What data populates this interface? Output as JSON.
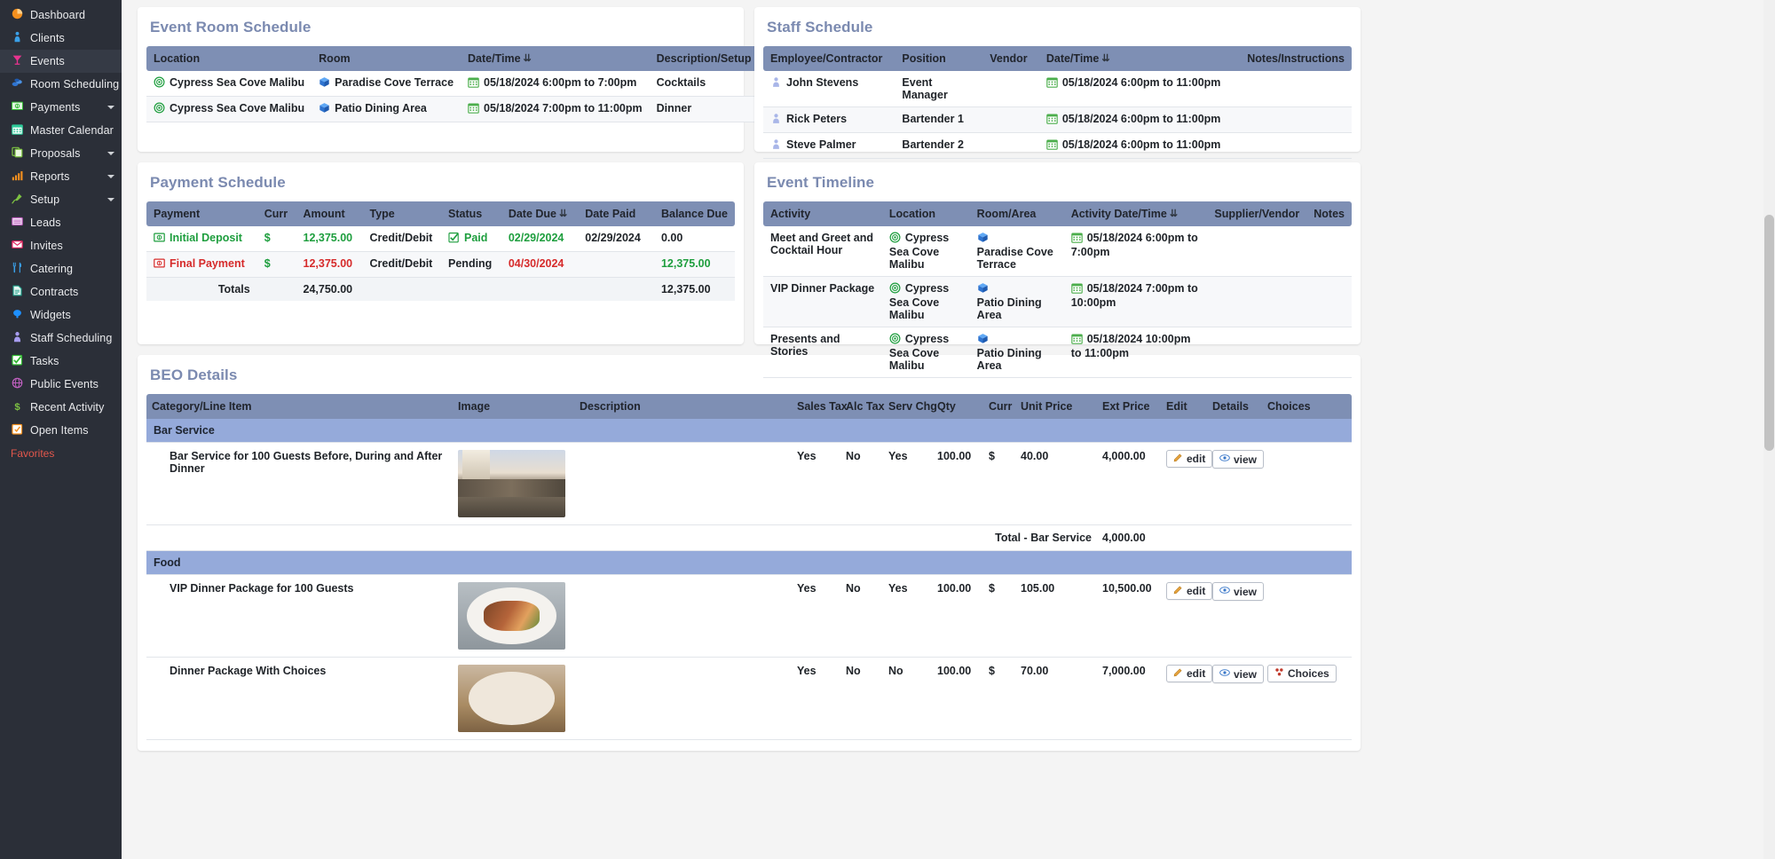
{
  "sidebar": {
    "items": [
      {
        "label": "Dashboard",
        "icon": "pie-chart-icon",
        "color": "#f5901e",
        "caret": false,
        "active": false
      },
      {
        "label": "Clients",
        "icon": "person-icon",
        "color": "#3aa0e8",
        "caret": false,
        "active": false
      },
      {
        "label": "Events",
        "icon": "cocktail-icon",
        "color": "#e8338f",
        "caret": false,
        "active": true
      },
      {
        "label": "Room Scheduling",
        "icon": "rooms-icon",
        "color": "#2f74d0",
        "caret": false,
        "active": false
      },
      {
        "label": "Payments",
        "icon": "money-icon",
        "color": "#2eb82e",
        "caret": true,
        "active": false
      },
      {
        "label": "Master Calendar",
        "icon": "calendar-icon",
        "color": "#2ecc9b",
        "caret": false,
        "active": false
      },
      {
        "label": "Proposals",
        "icon": "documents-icon",
        "color": "#7dc242",
        "caret": true,
        "active": false
      },
      {
        "label": "Reports",
        "icon": "bar-chart-icon",
        "color": "#f5901e",
        "caret": true,
        "active": false
      },
      {
        "label": "Setup",
        "icon": "plug-icon",
        "color": "#7dc242",
        "caret": true,
        "active": false
      },
      {
        "label": "Leads",
        "icon": "list-icon",
        "color": "#c060c0",
        "caret": false,
        "active": false
      },
      {
        "label": "Invites",
        "icon": "envelope-icon",
        "color": "#e0245e",
        "caret": false,
        "active": false
      },
      {
        "label": "Catering",
        "icon": "cutlery-icon",
        "color": "#3aa0e8",
        "caret": false,
        "active": false
      },
      {
        "label": "Contracts",
        "icon": "contract-icon",
        "color": "#1fa08a",
        "caret": false,
        "active": false
      },
      {
        "label": "Widgets",
        "icon": "widget-icon",
        "color": "#1e90ff",
        "caret": false,
        "active": false
      },
      {
        "label": "Staff Scheduling",
        "icon": "staff-icon",
        "color": "#a79cf0",
        "caret": false,
        "active": false
      },
      {
        "label": "Tasks",
        "icon": "checkbox-icon",
        "color": "#2eb82e",
        "caret": false,
        "active": false
      },
      {
        "label": "Public Events",
        "icon": "globe-icon",
        "color": "#c060c0",
        "caret": false,
        "active": false
      },
      {
        "label": "Recent Activity",
        "icon": "dollar-icon",
        "color": "#7dc242",
        "caret": false,
        "active": false
      },
      {
        "label": "Open Items",
        "icon": "openitems-icon",
        "color": "#f5901e",
        "caret": false,
        "active": false
      }
    ],
    "favorites_label": "Favorites"
  },
  "event_room_schedule": {
    "title": "Event Room Schedule",
    "columns": [
      "Location",
      "Room",
      "Date/Time",
      "Description/Setup"
    ],
    "sort_column": "Date/Time",
    "rows": [
      {
        "location": "Cypress Sea Cove Malibu",
        "room": "Paradise Cove Terrace",
        "datetime": "05/18/2024 6:00pm to 7:00pm",
        "description": "Cocktails"
      },
      {
        "location": "Cypress Sea Cove Malibu",
        "room": "Patio Dining Area",
        "datetime": "05/18/2024 7:00pm to 11:00pm",
        "description": "Dinner"
      }
    ]
  },
  "staff_schedule": {
    "title": "Staff Schedule",
    "columns": [
      "Employee/Contractor",
      "Position",
      "Vendor",
      "Date/Time",
      "Notes/Instructions"
    ],
    "sort_column": "Date/Time",
    "rows": [
      {
        "employee": "John Stevens",
        "position": "Event Manager",
        "vendor": "",
        "datetime": "05/18/2024 6:00pm to 11:00pm",
        "notes": ""
      },
      {
        "employee": "Rick Peters",
        "position": "Bartender 1",
        "vendor": "",
        "datetime": "05/18/2024 6:00pm to 11:00pm",
        "notes": ""
      },
      {
        "employee": "Steve Palmer",
        "position": "Bartender 2",
        "vendor": "",
        "datetime": "05/18/2024 6:00pm to 11:00pm",
        "notes": ""
      }
    ]
  },
  "payment_schedule": {
    "title": "Payment Schedule",
    "columns": [
      "Payment",
      "Curr",
      "Amount",
      "Type",
      "Status",
      "Date Due",
      "Date Paid",
      "Balance Due"
    ],
    "sort_column": "Date Due",
    "rows": [
      {
        "payment": "Initial Deposit",
        "curr": "$",
        "amount": "12,375.00",
        "type": "Credit/Debit",
        "status": "Paid",
        "date_due": "02/29/2024",
        "date_paid": "02/29/2024",
        "balance_due": "0.00",
        "state": "paid"
      },
      {
        "payment": "Final Payment",
        "curr": "$",
        "amount": "12,375.00",
        "type": "Credit/Debit",
        "status": "Pending",
        "date_due": "04/30/2024",
        "date_paid": "",
        "balance_due": "12,375.00",
        "state": "pending"
      }
    ],
    "totals_label": "Totals",
    "totals_amount": "24,750.00",
    "totals_balance": "12,375.00"
  },
  "event_timeline": {
    "title": "Event Timeline",
    "columns": [
      "Activity",
      "Location",
      "Room/Area",
      "Activity Date/Time",
      "Supplier/Vendor",
      "Notes"
    ],
    "sort_column": "Activity Date/Time",
    "rows": [
      {
        "activity": "Meet and Greet and Cocktail Hour",
        "location": "Cypress Sea Cove Malibu",
        "room": "Paradise Cove Terrace",
        "datetime": "05/18/2024 6:00pm to 7:00pm",
        "supplier": "",
        "notes": ""
      },
      {
        "activity": "VIP Dinner Package",
        "location": "Cypress Sea Cove Malibu",
        "room": "Patio Dining Area",
        "datetime": "05/18/2024 7:00pm to 10:00pm",
        "supplier": "",
        "notes": ""
      },
      {
        "activity": "Presents and Stories",
        "location": "Cypress Sea Cove Malibu",
        "room": "Patio Dining Area",
        "datetime": "05/18/2024 10:00pm to 11:00pm",
        "supplier": "",
        "notes": ""
      }
    ]
  },
  "beo": {
    "title": "BEO Details",
    "columns": [
      "Category/Line Item",
      "Image",
      "Description",
      "Sales Tax",
      "Alc Tax",
      "Serv Chg",
      "Qty",
      "Curr",
      "Unit Price",
      "Ext Price",
      "Edit",
      "Details",
      "Choices"
    ],
    "edit_label": "edit",
    "view_label": "view",
    "choices_label": "Choices",
    "sections": [
      {
        "category": "Bar Service",
        "items": [
          {
            "name": "Bar Service for 100 Guests Before, During and After Dinner",
            "description": "",
            "sales_tax": "Yes",
            "alc_tax": "No",
            "serv_chg": "Yes",
            "qty": "100.00",
            "curr": "$",
            "unit_price": "40.00",
            "ext_price": "4,000.00",
            "image": "outdoor-event-photo",
            "has_choices": false
          }
        ],
        "total_label": "Total - Bar Service",
        "total_value": "4,000.00"
      },
      {
        "category": "Food",
        "items": [
          {
            "name": "VIP Dinner Package for 100 Guests",
            "description": "",
            "sales_tax": "Yes",
            "alc_tax": "No",
            "serv_chg": "Yes",
            "qty": "100.00",
            "curr": "$",
            "unit_price": "105.00",
            "ext_price": "10,500.00",
            "image": "steak-lobster-photo",
            "has_choices": false
          },
          {
            "name": "Dinner Package With Choices",
            "description": "",
            "sales_tax": "Yes",
            "alc_tax": "No",
            "serv_chg": "No",
            "qty": "100.00",
            "curr": "$",
            "unit_price": "70.00",
            "ext_price": "7,000.00",
            "image": "dinner-plate-photo",
            "has_choices": true
          }
        ]
      }
    ]
  },
  "colors": {
    "sidebar_bg": "#2b2f38",
    "header_blue": "#7e8fb4",
    "category_blue": "#95aada",
    "title_blue": "#7b8ab0",
    "green": "#1e9e3e",
    "red": "#d62b2b"
  }
}
